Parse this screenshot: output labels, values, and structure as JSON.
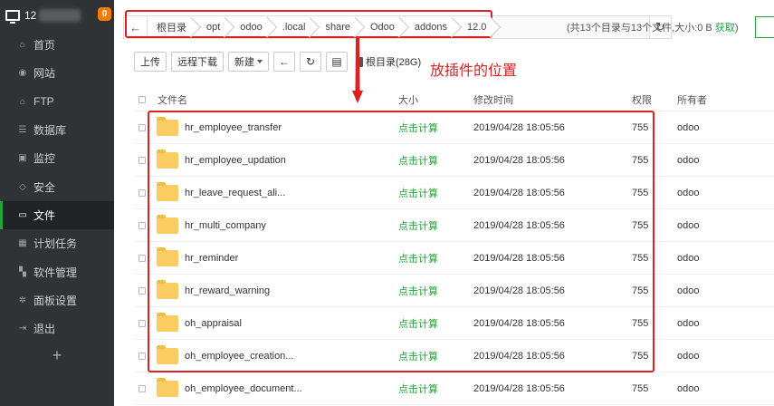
{
  "sidebar": {
    "host": "12",
    "badge": "0",
    "items": [
      {
        "label": "首页",
        "icon": "home-icon",
        "glyph": "⌂"
      },
      {
        "label": "网站",
        "icon": "globe-icon",
        "glyph": "◉"
      },
      {
        "label": "FTP",
        "icon": "ftp-icon",
        "glyph": "⌂"
      },
      {
        "label": "数据库",
        "icon": "database-icon",
        "glyph": "☰"
      },
      {
        "label": "监控",
        "icon": "monitor-icon",
        "glyph": "▣"
      },
      {
        "label": "安全",
        "icon": "shield-icon",
        "glyph": "◇"
      },
      {
        "label": "文件",
        "icon": "folder-icon",
        "glyph": "▭"
      },
      {
        "label": "计划任务",
        "icon": "calendar-icon",
        "glyph": "▦"
      },
      {
        "label": "软件管理",
        "icon": "apps-icon",
        "glyph": "▚"
      },
      {
        "label": "面板设置",
        "icon": "gear-icon",
        "glyph": "✲"
      },
      {
        "label": "退出",
        "icon": "logout-icon",
        "glyph": "⇥"
      }
    ],
    "plus": "+"
  },
  "path": {
    "back_glyph": "←",
    "crumbs": [
      "根目录",
      "opt",
      "odoo",
      ".local",
      "share",
      "Odoo",
      "addons",
      "12.0"
    ],
    "refresh_glyph": "↻"
  },
  "summary": {
    "text": "(共13个目录与13个文件,大小:0 B ",
    "link": "获取",
    "close": ")"
  },
  "toolbar": {
    "upload": "上传",
    "remote_download": "远程下载",
    "new": "新建",
    "back_glyph": "←",
    "refresh_glyph": "↻",
    "terminal_glyph": "▤",
    "disk": "根目录(28G)"
  },
  "annotation": "放插件的位置",
  "table": {
    "headers": {
      "name": "文件名",
      "size": "大小",
      "time": "修改时间",
      "perm": "权限",
      "owner": "所有者"
    },
    "rows": [
      {
        "name": "hr_employee_transfer",
        "size": "点击计算",
        "time": "2019/04/28 18:05:56",
        "perm": "755",
        "owner": "odoo"
      },
      {
        "name": "hr_employee_updation",
        "size": "点击计算",
        "time": "2019/04/28 18:05:56",
        "perm": "755",
        "owner": "odoo"
      },
      {
        "name": "hr_leave_request_ali...",
        "size": "点击计算",
        "time": "2019/04/28 18:05:56",
        "perm": "755",
        "owner": "odoo"
      },
      {
        "name": "hr_multi_company",
        "size": "点击计算",
        "time": "2019/04/28 18:05:56",
        "perm": "755",
        "owner": "odoo"
      },
      {
        "name": "hr_reminder",
        "size": "点击计算",
        "time": "2019/04/28 18:05:56",
        "perm": "755",
        "owner": "odoo"
      },
      {
        "name": "hr_reward_warning",
        "size": "点击计算",
        "time": "2019/04/28 18:05:56",
        "perm": "755",
        "owner": "odoo"
      },
      {
        "name": "oh_appraisal",
        "size": "点击计算",
        "time": "2019/04/28 18:05:56",
        "perm": "755",
        "owner": "odoo"
      },
      {
        "name": "oh_employee_creation...",
        "size": "点击计算",
        "time": "2019/04/28 18:05:56",
        "perm": "755",
        "owner": "odoo"
      },
      {
        "name": "oh_employee_document...",
        "size": "点击计算",
        "time": "2019/04/28 18:05:56",
        "perm": "755",
        "owner": "odoo"
      }
    ]
  },
  "colors": {
    "accent": "#20a53a",
    "annotation": "#e02020",
    "sidebar": "#2f3336",
    "folder": "#f9cd62"
  }
}
